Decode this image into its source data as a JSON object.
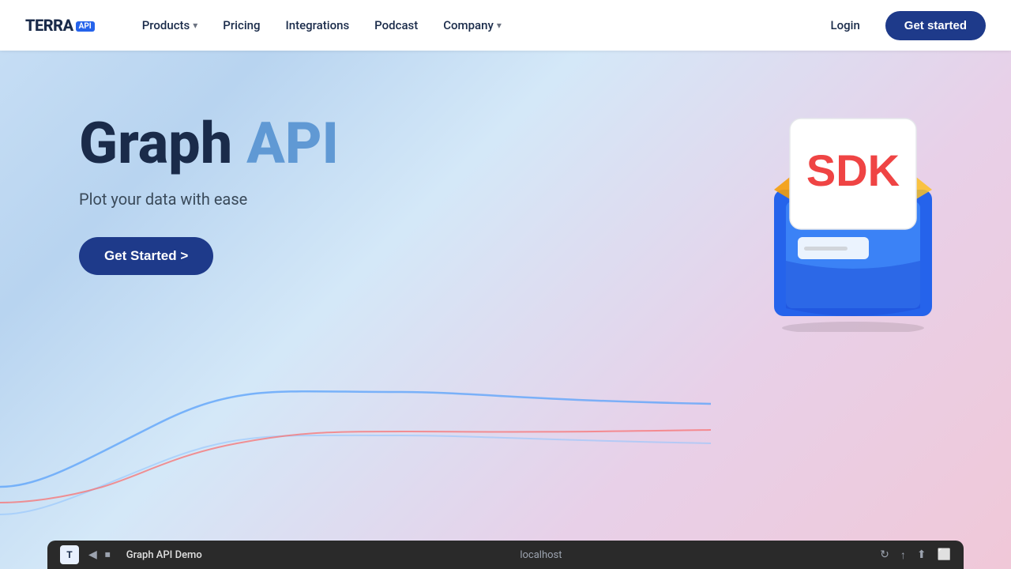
{
  "nav": {
    "logo": {
      "name": "TERRA",
      "badge": "API"
    },
    "items": [
      {
        "label": "Products",
        "hasDropdown": true
      },
      {
        "label": "Pricing",
        "hasDropdown": false
      },
      {
        "label": "Integrations",
        "hasDropdown": false
      },
      {
        "label": "Podcast",
        "hasDropdown": false
      },
      {
        "label": "Company",
        "hasDropdown": true
      }
    ],
    "login_label": "Login",
    "get_started_label": "Get started"
  },
  "hero": {
    "title_main": "Graph ",
    "title_accent": "API",
    "subtitle": "Plot your data with ease",
    "cta_label": "Get Started >"
  },
  "sdk": {
    "label": "SDK"
  },
  "video_bar": {
    "icon_letter": "T",
    "title": "Graph API Demo",
    "url": "localhost",
    "transport_icons": [
      "◀",
      "⏹"
    ],
    "right_icons": [
      "↻",
      "↑",
      "⬆",
      "⬜"
    ]
  }
}
